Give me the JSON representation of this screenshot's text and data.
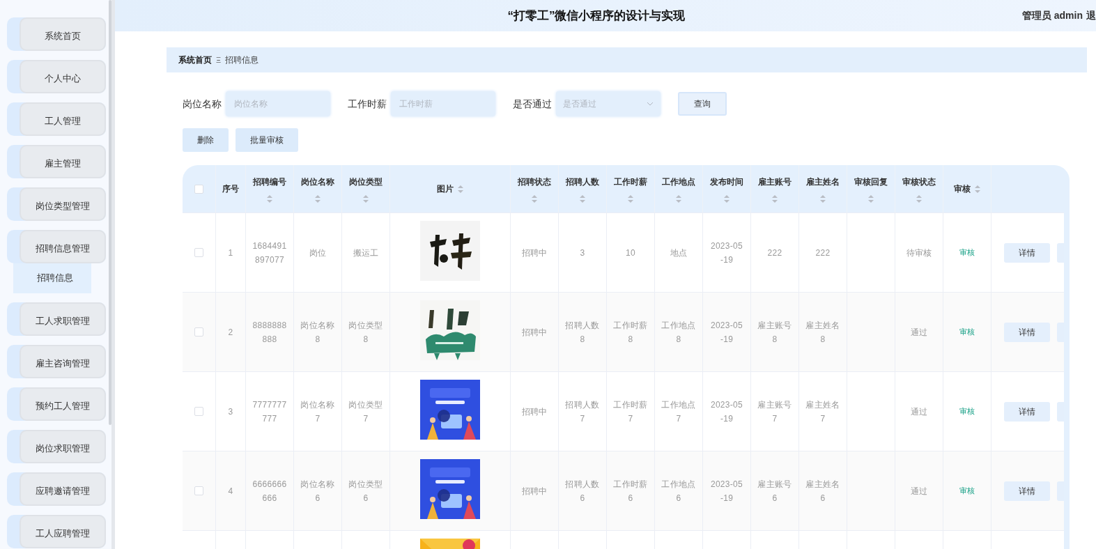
{
  "sidebar": {
    "items": [
      {
        "label": "系统首页"
      },
      {
        "label": "个人中心"
      },
      {
        "label": "工人管理"
      },
      {
        "label": "雇主管理"
      },
      {
        "label": "岗位类型管理"
      },
      {
        "label": "招聘信息管理",
        "children": [
          {
            "label": "招聘信息",
            "selected": true
          }
        ]
      },
      {
        "label": "工人求职管理"
      },
      {
        "label": "雇主咨询管理"
      },
      {
        "label": "预约工人管理"
      },
      {
        "label": "岗位求职管理"
      },
      {
        "label": "应聘邀请管理"
      },
      {
        "label": "工人应聘管理"
      }
    ]
  },
  "header": {
    "title": "“打零工”微信小程序的设计与实现",
    "user": "管理员 admin",
    "logout": "退"
  },
  "breadcrumb": [
    "系统首页",
    "招聘信息"
  ],
  "breadcrumb_separator": "Ξ",
  "search": {
    "fields": [
      {
        "kind": "input",
        "label": "岗位名称",
        "placeholder": "岗位名称"
      },
      {
        "kind": "input",
        "label": "工作时薪",
        "placeholder": "工作时薪"
      },
      {
        "kind": "select",
        "label": "是否通过",
        "placeholder": "是否通过"
      }
    ],
    "button": "查询"
  },
  "toolbar": [
    "删除",
    "批量审核"
  ],
  "table": {
    "header_checked": false,
    "columns": [
      {
        "label": "序号",
        "sortable": false
      },
      {
        "label": "招聘编号",
        "sortable": true
      },
      {
        "label": "岗位名称",
        "sortable": true
      },
      {
        "label": "岗位类型",
        "sortable": true
      },
      {
        "label": "图片",
        "sortable": true,
        "kind": "picture"
      },
      {
        "label": "招聘状态",
        "sortable": true
      },
      {
        "label": "招聘人数",
        "sortable": true
      },
      {
        "label": "工作时薪",
        "sortable": true
      },
      {
        "label": "工作地点",
        "sortable": true
      },
      {
        "label": "发布时间",
        "sortable": true
      },
      {
        "label": "雇主账号",
        "sortable": true
      },
      {
        "label": "雇主姓名",
        "sortable": true
      },
      {
        "label": "审核回复",
        "sortable": true
      },
      {
        "label": "审核状态",
        "sortable": true
      },
      {
        "label": "审核",
        "sortable": true,
        "kind": "action"
      }
    ],
    "rows": [
      {
        "checked": false,
        "cells": [
          "1",
          "1684491897077",
          "岗位",
          "搬运工",
          {
            "kind": "picture"
          },
          "招聘中",
          "3",
          "10",
          "地点",
          "2023-05-19",
          "222",
          "222",
          null,
          "待审核",
          "审核"
        ],
        "actions": [
          "详情"
        ]
      },
      {
        "checked": false,
        "cells": [
          "2",
          "8888888888",
          "岗位名称8",
          "岗位类型8",
          {
            "kind": "picture"
          },
          "招聘中",
          "招聘人数8",
          "工作时薪8",
          "工作地点8",
          "2023-05-19",
          "雇主账号8",
          "雇主姓名8",
          null,
          "通过",
          "审核"
        ],
        "actions": [
          "详情"
        ]
      },
      {
        "checked": false,
        "cells": [
          "3",
          "7777777777",
          "岗位名称7",
          "岗位类型7",
          {
            "kind": "picture"
          },
          "招聘中",
          "招聘人数7",
          "工作时薪7",
          "工作地点7",
          "2023-05-19",
          "雇主账号7",
          "雇主姓名7",
          null,
          "通过",
          "审核"
        ],
        "actions": [
          "详情"
        ]
      },
      {
        "checked": false,
        "cells": [
          "4",
          "6666666666",
          "岗位名称6",
          "岗位类型6",
          {
            "kind": "picture"
          },
          "招聘中",
          "招聘人数6",
          "工作时薪6",
          "工作地点6",
          "2023-05-19",
          "雇主账号6",
          "雇主姓名6",
          null,
          "通过",
          "审核"
        ],
        "actions": [
          "详情"
        ]
      },
      {
        "cells": [
          null,
          null,
          null,
          null,
          {
            "kind": "picture"
          }
        ]
      }
    ]
  }
}
